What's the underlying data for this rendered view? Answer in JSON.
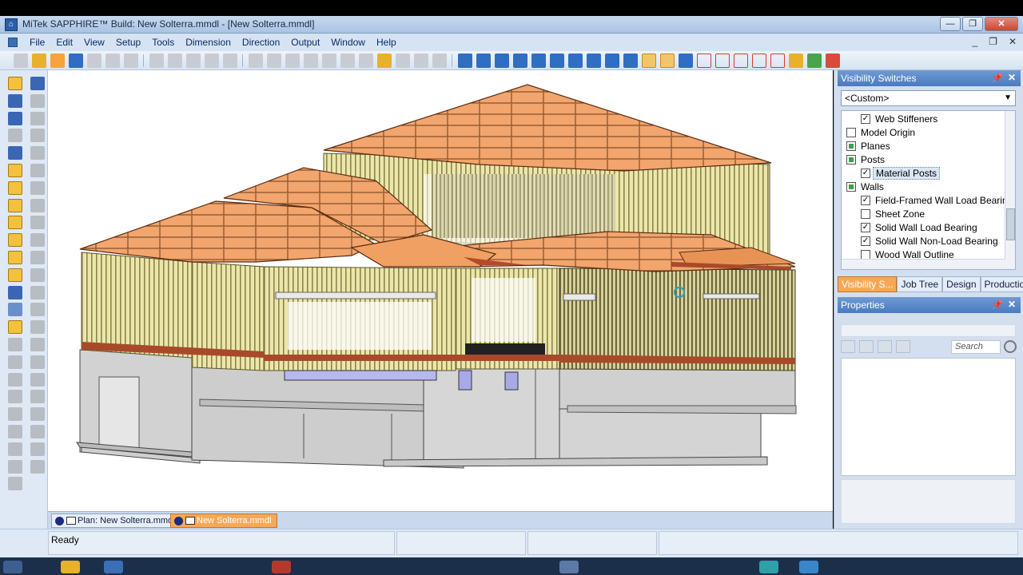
{
  "window": {
    "title": "MiTek SAPPHIRE™ Build: New Solterra.mmdl - [New Solterra.mmdl]"
  },
  "menu": {
    "items": [
      "File",
      "Edit",
      "View",
      "Setup",
      "Tools",
      "Dimension",
      "Direction",
      "Output",
      "Window",
      "Help"
    ]
  },
  "visibility_panel": {
    "title": "Visibility Switches",
    "preset": "<Custom>",
    "items": [
      {
        "label": "Web Stiffeners",
        "state": "checked",
        "indent": 1
      },
      {
        "label": "Model Origin",
        "state": "unchecked",
        "indent": 0
      },
      {
        "label": "Planes",
        "state": "mixed",
        "indent": 0
      },
      {
        "label": "Posts",
        "state": "mixed",
        "indent": 0
      },
      {
        "label": "Material Posts",
        "state": "checked",
        "indent": 1,
        "selected": true
      },
      {
        "label": "Walls",
        "state": "mixed",
        "indent": 0
      },
      {
        "label": "Field-Framed Wall Load Bearing",
        "state": "checked",
        "indent": 1
      },
      {
        "label": "Sheet Zone",
        "state": "unchecked",
        "indent": 1
      },
      {
        "label": "Solid Wall Load Bearing",
        "state": "checked",
        "indent": 1
      },
      {
        "label": "Solid Wall Non-Load Bearing",
        "state": "checked",
        "indent": 1
      },
      {
        "label": "Wood Wall Outline",
        "state": "unchecked",
        "indent": 1
      }
    ]
  },
  "panel_tabs": [
    {
      "label": "Visibility S...",
      "active": true
    },
    {
      "label": "Job Tree",
      "active": false
    },
    {
      "label": "Design",
      "active": false
    },
    {
      "label": "Production...",
      "active": false
    }
  ],
  "properties_panel": {
    "title": "Properties",
    "search_placeholder": "Search"
  },
  "doc_tabs": [
    {
      "label": "Plan: New Solterra.mmdl",
      "active": false
    },
    {
      "label": "New Solterra.mmdl",
      "active": true
    }
  ],
  "status": {
    "text": "Ready"
  },
  "colors": {
    "roof": "#f4a36a",
    "wall_framing": "#e8e29a",
    "foundation": "#d4d4d4",
    "accent_tab": "#f7a857"
  }
}
